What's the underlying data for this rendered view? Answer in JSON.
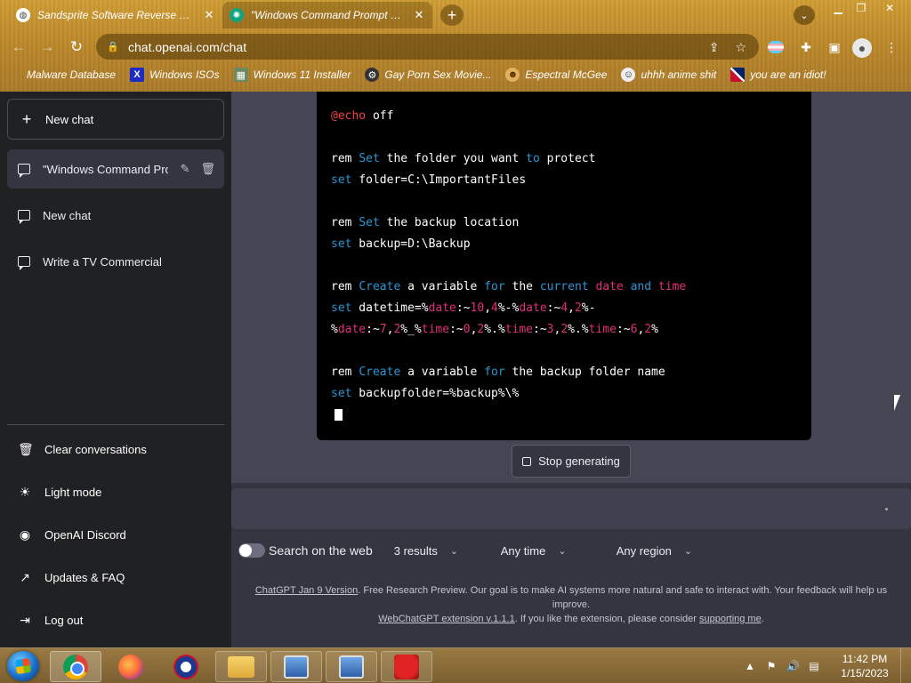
{
  "browser": {
    "tabs": [
      {
        "title": "Sandsprite Software Reverse Eng",
        "close": "✕"
      },
      {
        "title": "\"Windows Command Prompt C Dr",
        "close": "✕"
      }
    ],
    "new_tab": "+",
    "url": "chat.openai.com/chat",
    "bookmarks": [
      {
        "label": "Malware Database",
        "icon": "none"
      },
      {
        "label": "Windows ISOs",
        "icon": "x"
      },
      {
        "label": "Windows 11 Installer",
        "icon": "img"
      },
      {
        "label": "Gay Porn Sex Movie...",
        "icon": "gear"
      },
      {
        "label": "Espectral McGee",
        "icon": "face"
      },
      {
        "label": "uhhh anime shit",
        "icon": "anime"
      },
      {
        "label": "you are an idiot!",
        "icon": "uk"
      }
    ]
  },
  "sidebar": {
    "new_chat": "New chat",
    "conversations": [
      {
        "label": "\"Windows Command Pro",
        "active": true
      },
      {
        "label": "New chat",
        "active": false
      },
      {
        "label": "Write a TV Commercial",
        "active": false
      }
    ],
    "menu": [
      {
        "label": "Clear conversations",
        "icon": "trash-icon"
      },
      {
        "label": "Light mode",
        "icon": "sun-icon"
      },
      {
        "label": "OpenAI Discord",
        "icon": "discord-icon"
      },
      {
        "label": "Updates & FAQ",
        "icon": "external-link-icon"
      },
      {
        "label": "Log out",
        "icon": "logout-icon"
      }
    ]
  },
  "code": {
    "l1_at": "@echo",
    "l1_rest": " off",
    "l2_rem": "rem ",
    "l2_kw": "Set",
    "l2_mid": " the folder you want ",
    "l2_kw2": "to",
    "l2_end": " protect",
    "l3_kw": "set",
    "l3_rest": " folder=C:\\ImportantFiles",
    "l4_rem": "rem ",
    "l4_kw": "Set",
    "l4_rest": " the backup location",
    "l5_kw": "set",
    "l5_rest": " backup=D:\\Backup",
    "l6_rem": "rem ",
    "l6_kw": "Create",
    "l6_a": " a variable ",
    "l6_kw2": "for",
    "l6_b": " the ",
    "l6_kw3": "current",
    "l6_c": " ",
    "l6_kw4": "date",
    "l6_d": " ",
    "l6_kw5": "and",
    "l6_e": " ",
    "l6_kw6": "time",
    "l7_kw": "set",
    "l7_a": " datetime=%",
    "l7_v1": "date",
    "l7_b": ":~",
    "l7_n1": "10",
    "l7_c": ",",
    "l7_n2": "4",
    "l7_d": "%-%",
    "l7_v2": "date",
    "l7_e": ":~",
    "l7_n3": "4",
    "l7_f": ",",
    "l7_n4": "2",
    "l7_g": "%-",
    "l8_a": "%",
    "l8_v1": "date",
    "l8_b": ":~",
    "l8_n1": "7",
    "l8_c": ",",
    "l8_n2": "2",
    "l8_d": "%_%",
    "l8_v2": "time",
    "l8_e": ":~",
    "l8_n3": "0",
    "l8_f": ",",
    "l8_n4": "2",
    "l8_g": "%.%",
    "l8_v3": "time",
    "l8_h": ":~",
    "l8_n5": "3",
    "l8_i": ",",
    "l8_n6": "2",
    "l8_j": "%.%",
    "l8_v4": "time",
    "l8_k": ":~",
    "l8_n7": "6",
    "l8_l": ",",
    "l8_n8": "2",
    "l8_m": "%",
    "l9_rem": "rem ",
    "l9_kw": "Create",
    "l9_a": " a variable ",
    "l9_kw2": "for",
    "l9_b": " the backup folder name",
    "l10_kw": "set",
    "l10_rest": " backupfolder=%backup%\\%"
  },
  "stop_generating": "Stop generating",
  "web": {
    "label": "Search on the web",
    "results": "3 results",
    "time": "Any time",
    "region": "Any region"
  },
  "footer": {
    "version_link": "ChatGPT Jan 9 Version",
    "text": ". Free Research Preview. Our goal is to make AI systems more natural and safe to interact with. Your feedback will help us improve.",
    "ext_link": "WebChatGPT extension v.1.1.1",
    "ext_text": ". If you like the extension, please consider ",
    "support_link": "supporting me",
    "end": "."
  },
  "taskbar": {
    "time": "11:42 PM",
    "date": "1/15/2023"
  }
}
